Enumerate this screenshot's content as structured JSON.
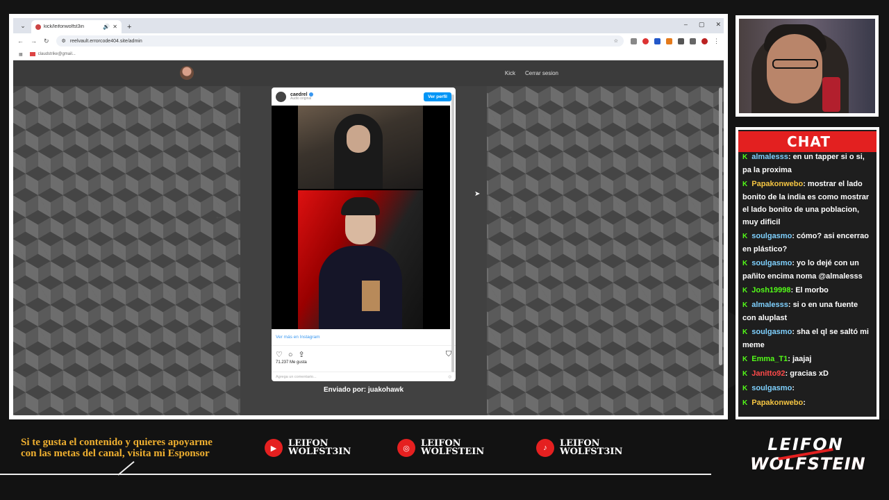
{
  "browser": {
    "tab_title": "kick/leifonwolfst3in",
    "url": "reelvault.errorcode404.site/admin",
    "bookmark_gmail": "claudstrike@gmail..."
  },
  "site": {
    "nav_links": [
      "Kick",
      "Cerrar sesion"
    ]
  },
  "instagram": {
    "username": "caedrel",
    "audio": "Audio original",
    "follow_label": "Ver perfil",
    "more_label": "Ver más en Instagram",
    "likes": "71.237 Me gusta",
    "comment_placeholder": "Agrega un comentario..."
  },
  "sent_by": "Enviado por: juakohawk",
  "chat": {
    "title": "CHAT",
    "messages": [
      {
        "user": "almalesss",
        "color": "#7fd1ff",
        "text": ": en un tapper si o si, pa la proxima"
      },
      {
        "user": "Papakonwebo",
        "color": "#f5c542",
        "text": ": mostrar el lado bonito de la india es como mostrar el lado bonito de una poblacion, muy dificil"
      },
      {
        "user": "soulgasmo",
        "color": "#7fd1ff",
        "text": ": cómo? asi encerrao en plástico?"
      },
      {
        "user": "soulgasmo",
        "color": "#7fd1ff",
        "text": ": yo lo dejé con un pañito encima noma @almalesss"
      },
      {
        "user": "Josh19998",
        "color": "#53fc18",
        "text": ": El morbo"
      },
      {
        "user": "almalesss",
        "color": "#7fd1ff",
        "text": ": si o en una fuente con aluplast"
      },
      {
        "user": "soulgasmo",
        "color": "#7fd1ff",
        "text": ": sha el ql se saltó mi meme"
      },
      {
        "user": "Emma_T1",
        "color": "#53fc18",
        "text": ": jaajaj"
      },
      {
        "user": "Janitto92",
        "color": "#ff4a4a",
        "text": ": gracias xD"
      },
      {
        "user": "soulgasmo",
        "color": "#7fd1ff",
        "text": ":"
      },
      {
        "user": "Papakonwebo",
        "color": "#f5c542",
        "text": ":"
      }
    ]
  },
  "footer": {
    "sponsor_text": "Si te gusta el contenido y quieres apoyarme con las metas del canal, visita mi Esponsor",
    "socials": [
      {
        "icon": "youtube-icon",
        "line1": "LEIFON",
        "line2": "WOLFST3IN"
      },
      {
        "icon": "instagram-icon",
        "line1": "LEIFON",
        "line2": "WOLFSTEIN"
      },
      {
        "icon": "tiktok-icon",
        "line1": "LEIFON",
        "line2": "WOLFST3IN"
      }
    ],
    "brand_line1": "LEIFON",
    "brand_line2": "WOLFSTEIN"
  }
}
